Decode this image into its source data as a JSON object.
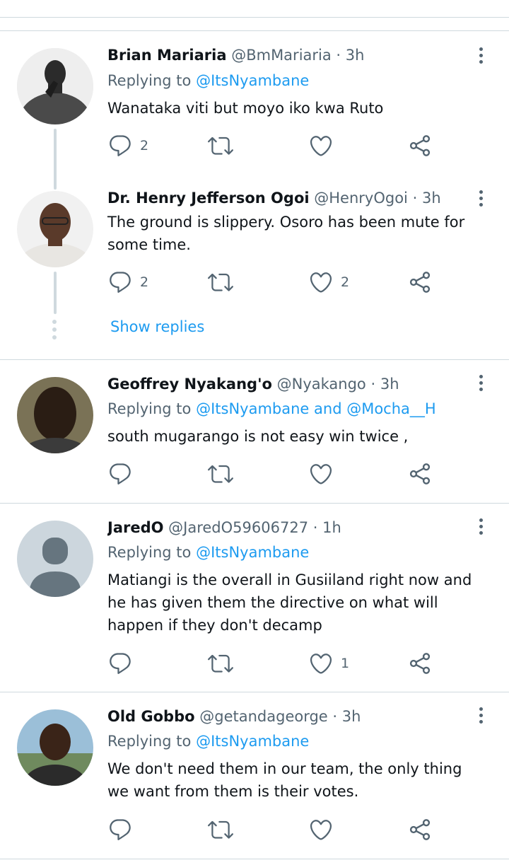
{
  "tweets": [
    {
      "name": "Brian Mariaria",
      "handle": "@BmMariaria",
      "sep": "·",
      "time": "3h",
      "replying_label": "Replying to",
      "replying_to": "@ItsNyambane",
      "text": "Wanataka viti but moyo iko kwa Ruto",
      "replies": "2",
      "retweets": "",
      "likes": ""
    },
    {
      "name": "Dr. Henry Jefferson Ogoi",
      "handle": "@HenryOgoi",
      "sep": "·",
      "time": "3h",
      "text": "The ground is slippery. Osoro has been mute for some time.",
      "replies": "2",
      "retweets": "",
      "likes": "2",
      "show_replies": "Show replies"
    },
    {
      "name": "Geoffrey Nyakang'o",
      "handle": "@Nyakango",
      "sep": "·",
      "time": "3h",
      "replying_label": "Replying to",
      "replying_to": "@ItsNyambane and @Mocha__H",
      "text": "south mugarango is not easy win twice ,",
      "replies": "",
      "retweets": "",
      "likes": ""
    },
    {
      "name": "JaredO",
      "handle": "@JaredO59606727",
      "sep": "·",
      "time": "1h",
      "replying_label": "Replying to",
      "replying_to": "@ItsNyambane",
      "text": "Matiangi is the overall in Gusiiland right now and he has given them the directive on what will happen if they don't decamp",
      "replies": "",
      "retweets": "",
      "likes": "1"
    },
    {
      "name": "Old Gobbo",
      "handle": "@getandageorge",
      "sep": "·",
      "time": "3h",
      "replying_label": "Replying to",
      "replying_to": "@ItsNyambane",
      "text": "We don't need them in our team, the only thing we want from them is their votes.",
      "replies": "",
      "retweets": "",
      "likes": ""
    }
  ],
  "icons": {
    "reply": "reply-icon",
    "retweet": "retweet-icon",
    "like": "like-icon",
    "share": "share-icon",
    "more": "more-icon"
  },
  "colors": {
    "accent": "#1d9bf0",
    "muted": "#536471",
    "border": "#cfd9de"
  }
}
